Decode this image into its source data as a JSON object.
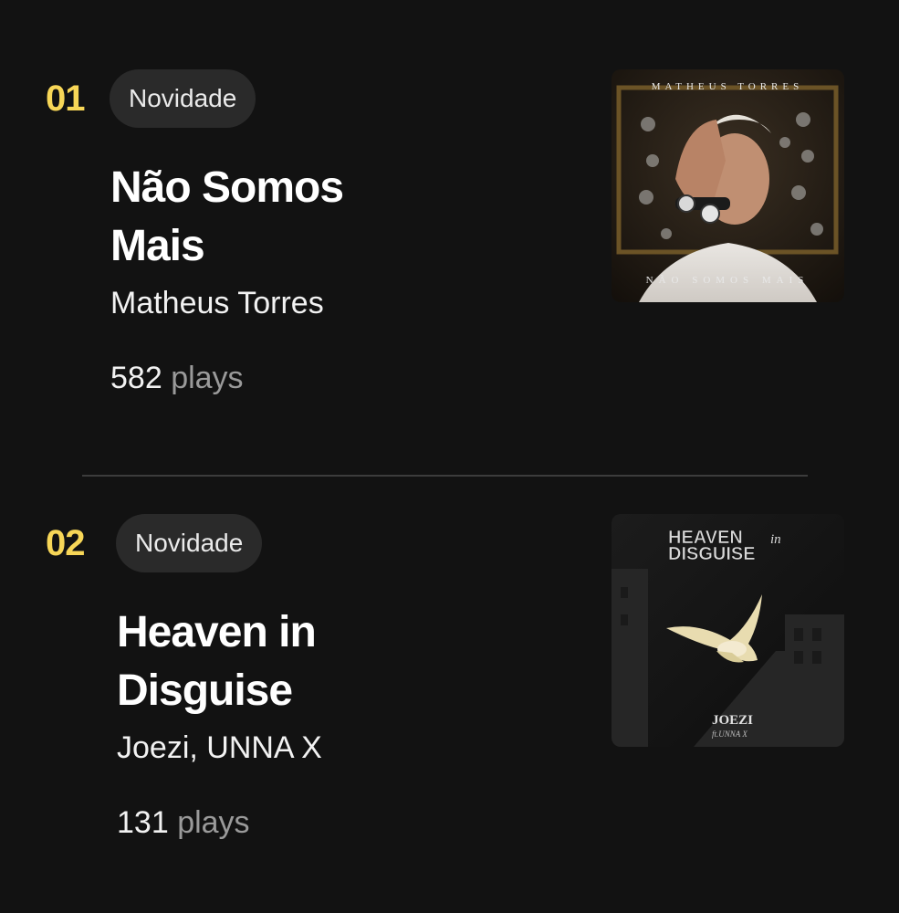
{
  "tracks": [
    {
      "rank": "01",
      "badge": "Novidade",
      "title": "Não Somos Mais",
      "artist": "Matheus Torres",
      "plays_count": "582",
      "plays_label": "plays",
      "cover": {
        "top_text": "MATHEUS TORRES",
        "bottom_text": "NÃO SOMOS MAIS"
      }
    },
    {
      "rank": "02",
      "badge": "Novidade",
      "title": "Heaven in Disguise",
      "artist": "Joezi, UNNA X",
      "plays_count": "131",
      "plays_label": "plays",
      "cover": {
        "title_line1": "HEAVEN",
        "title_in": "in",
        "title_line2": "DISGUISE",
        "artist_logo": "JOEZI",
        "feat_text": "ft.UNNA X"
      }
    }
  ],
  "colors": {
    "background": "#121212",
    "rank": "#f7d657",
    "badge_bg": "#2a2a2a",
    "muted": "#9a9a9a",
    "divider": "#3c3c3c"
  }
}
